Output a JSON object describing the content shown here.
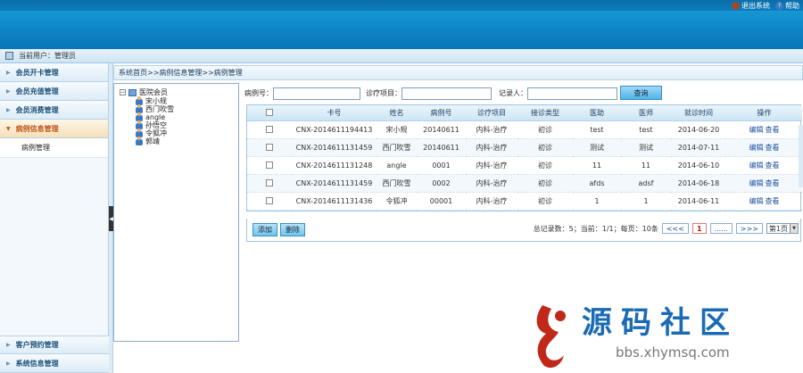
{
  "header": {
    "logout_label": "退出系统",
    "help_label": "帮助"
  },
  "userbar": {
    "text": "当前用户：管理员"
  },
  "sidebar": {
    "items": [
      {
        "label": "会员开卡管理"
      },
      {
        "label": "会员充值管理"
      },
      {
        "label": "会员消费管理"
      },
      {
        "label": "病例信息管理"
      }
    ],
    "submenu": {
      "label": "病例管理"
    },
    "bottom_items": [
      {
        "label": "客户预约管理"
      },
      {
        "label": "系统信息管理"
      }
    ]
  },
  "breadcrumb": "系统首页>>病例信息管理>>病例管理",
  "tree": {
    "root": "医院会员",
    "children": [
      "宋小规",
      "西门吹雪",
      "angle",
      "孙悟空",
      "令狐冲",
      "郭靖"
    ]
  },
  "search": {
    "case_no_label": "病例号：",
    "case_no_value": "",
    "item_label": "诊疗项目：",
    "item_value": "",
    "recorder_label": "记录人：",
    "recorder_value": "",
    "button": "查询"
  },
  "table": {
    "headers": [
      "卡号",
      "姓名",
      "病例号",
      "诊疗项目",
      "接诊类型",
      "医助",
      "医师",
      "就诊时间",
      "操作"
    ],
    "rows": [
      [
        "CNX-2014611194413",
        "宋小规",
        "20140611",
        "内科-治疗",
        "初诊",
        "test",
        "test",
        "2014-06-20"
      ],
      [
        "CNX-2014611131459",
        "西门吹雪",
        "20140611",
        "内科-治疗",
        "初诊",
        "测试",
        "测试",
        "2014-07-11"
      ],
      [
        "CNX-2014611131248",
        "angle",
        "0001",
        "内科-治疗",
        "初诊",
        "11",
        "11",
        "2014-06-10"
      ],
      [
        "CNX-2014611131459",
        "西门吹雪",
        "0002",
        "内科-治疗",
        "初诊",
        "afds",
        "adsf",
        "2014-06-18"
      ],
      [
        "CNX-2014611131436",
        "令狐冲",
        "00001",
        "内科-治疗",
        "初诊",
        "1",
        "1",
        "2014-06-11"
      ]
    ],
    "edit_label": "编辑",
    "view_label": "查看"
  },
  "toolbar": {
    "add_label": "添加",
    "delete_label": "删除"
  },
  "pager": {
    "summary": "总记录数：5；当前：1/1；每页：10条",
    "first": "<<<",
    "current": "1",
    "ellipsis": "......",
    "last": ">>>",
    "page_select": "第1页"
  },
  "watermark": {
    "title": "源码社区",
    "url": "bbs.xhymsq.com"
  }
}
